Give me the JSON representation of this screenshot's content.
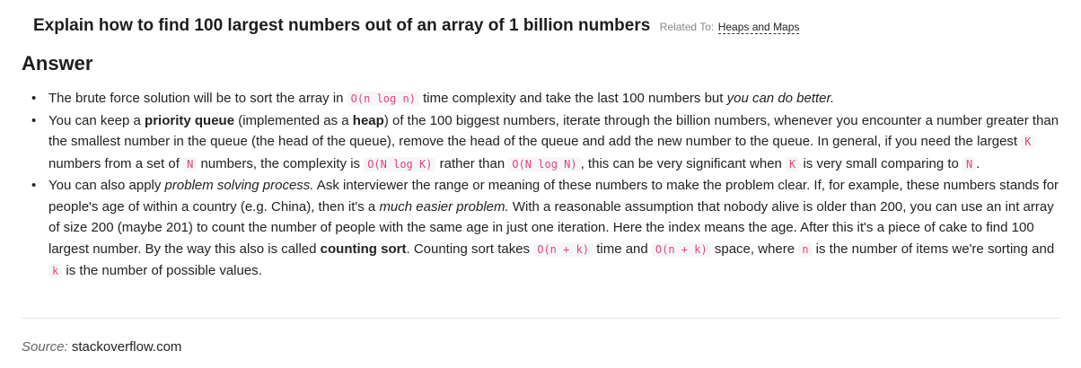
{
  "question": {
    "title": "Explain how to find 100 largest numbers out of an array of 1 billion numbers",
    "related_prefix": "Related To:",
    "related_link": "Heaps and Maps"
  },
  "answer": {
    "heading": "Answer",
    "items": [
      {
        "p1": "The brute force solution will be to sort the array in ",
        "c1": "O(n log n)",
        "p2": " time complexity and take the last 100 numbers but ",
        "em1": "you can do better."
      },
      {
        "p1": "You can keep a ",
        "b1": "priority queue",
        "p2": " (implemented as a ",
        "b2": "heap",
        "p3": ") of the 100 biggest numbers, iterate through the billion numbers, whenever you encounter a number greater than the smallest number in the queue (the head of the queue), remove the head of the queue and add the new number to the queue. In general, if you need the largest ",
        "c1": "K",
        "p4": " numbers from a set of ",
        "c2": "N",
        "p5": " numbers, the complexity is ",
        "c3": "O(N log K)",
        "p6": " rather than ",
        "c4": "O(N log N)",
        "p7": ", this can be very significant when ",
        "c5": "K",
        "p8": " is very small comparing to ",
        "c6": "N",
        "p9": "."
      },
      {
        "p1": "You can also apply ",
        "em1": "problem solving process.",
        "p2": " Ask interviewer the range or meaning of these numbers to make the problem clear. If, for example, these numbers stands for people's age of within a country (e.g. China), then it's a ",
        "em2": "much easier problem.",
        "p3": " With a reasonable assumption that nobody alive is older than 200, you can use an int array of size 200 (maybe 201) to count the number of people with the same age in just one iteration. Here the index means the age. After this it's a piece of cake to find 100 largest number. By the way this also is called ",
        "b1": "counting sort",
        "p4": ". Counting sort takes ",
        "c1": "O(n + k)",
        "p5": " time and ",
        "c2": "O(n + k)",
        "p6": " space, where ",
        "c3": "n",
        "p7": " is the number of items we're sorting and ",
        "c4": "k",
        "p8": " is the number of possible values."
      }
    ]
  },
  "source": {
    "label": "Source:",
    "value": "stackoverflow.com"
  }
}
